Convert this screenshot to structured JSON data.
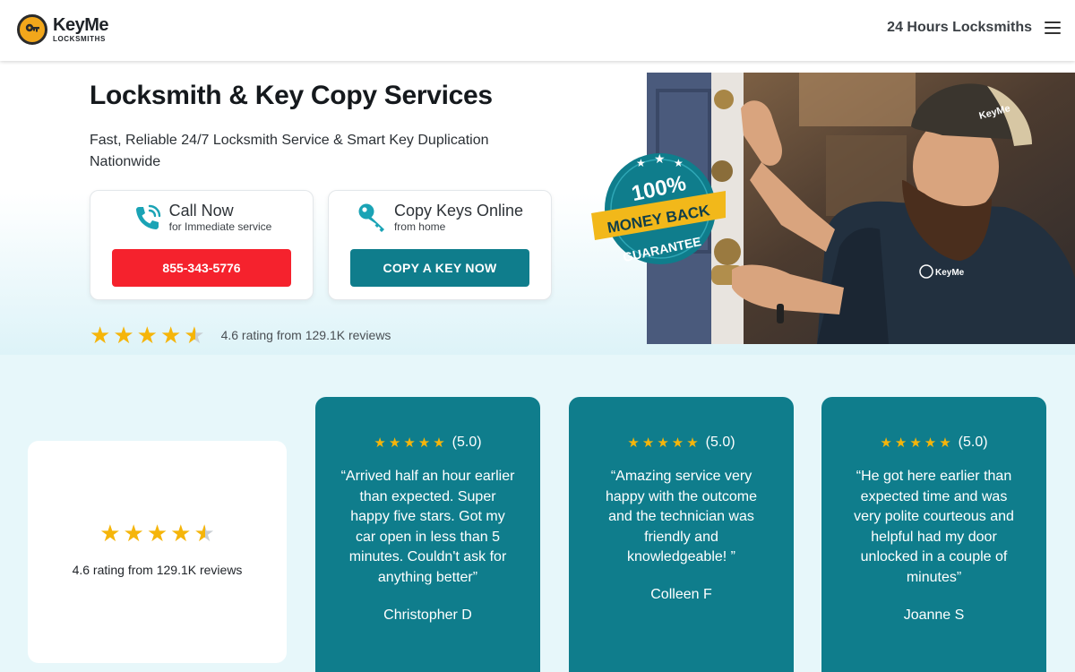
{
  "header": {
    "logo_name": "KeyMe",
    "logo_sub": "LOCKSMITHS",
    "link": "24 Hours Locksmiths"
  },
  "hero": {
    "title": "Locksmith & Key Copy Services",
    "subtitle": "Fast, Reliable 24/7 Locksmith Service & Smart Key Duplication Nationwide",
    "call_card": {
      "title": "Call Now",
      "note": "for Immediate service",
      "button": "855-343-5776"
    },
    "copy_card": {
      "title": "Copy Keys Online",
      "note": "from home",
      "button": "COPY A KEY NOW"
    },
    "rating_value": 4.6,
    "rating_text": "4.6 rating from 129.1K reviews",
    "badge": {
      "line1": "100%",
      "line2": "MONEY BACK",
      "line3": "GUARANTEE"
    },
    "photo_shirt_logo": "KeyMe"
  },
  "reviews": {
    "summary_rating": 4.6,
    "summary_text": "4.6 rating from 129.1K reviews",
    "items": [
      {
        "score": "(5.0)",
        "quote": "“Arrived half an hour earlier than expected. Super happy five stars. Got my car open in less than 5 minutes. Couldn't ask for anything better”",
        "name": "Christopher D"
      },
      {
        "score": "(5.0)",
        "quote": "“Amazing service very happy with the outcome and the technician was friendly and knowledgeable! ”",
        "name": "Colleen F"
      },
      {
        "score": "(5.0)",
        "quote": "“He got here earlier than expected time and was very polite courteous and helpful had my door unlocked in a couple of minutes”",
        "name": "Joanne S"
      }
    ]
  },
  "colors": {
    "brand_orange": "#f2a71b",
    "call_red": "#f5222d",
    "teal": "#0f7d8c",
    "star": "#f5b50a"
  }
}
